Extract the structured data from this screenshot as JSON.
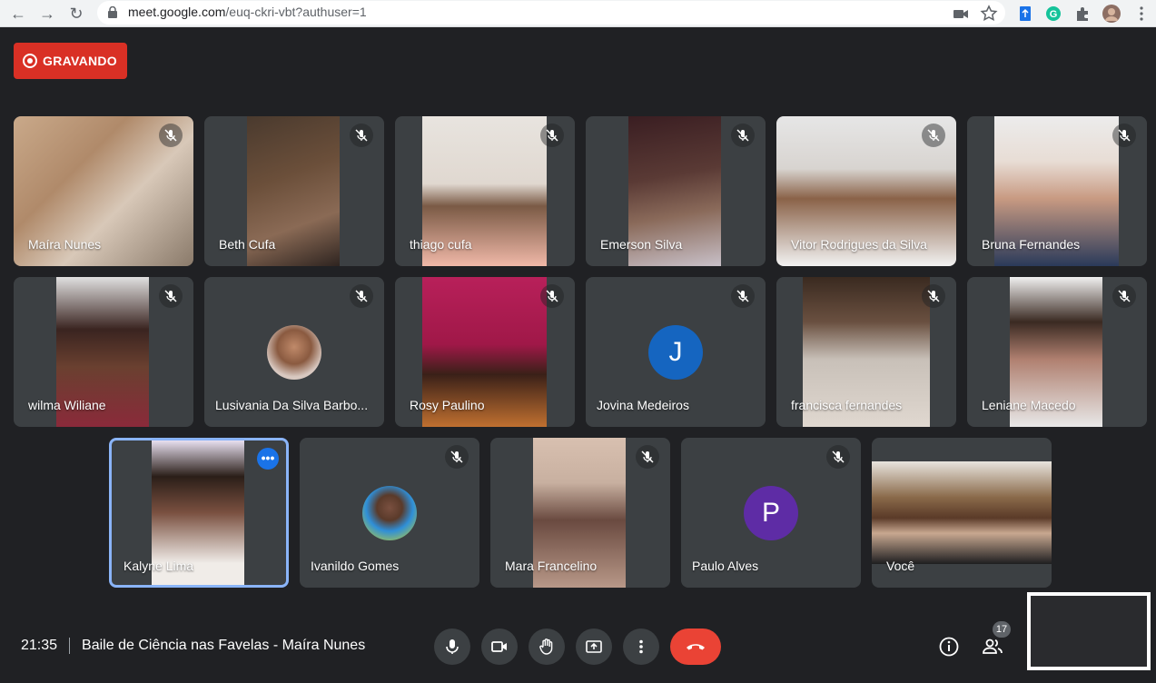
{
  "browser": {
    "url_host": "meet.google.com",
    "url_path": "/euq-ckri-vbt?authuser=1"
  },
  "recording": {
    "label": "GRAVANDO"
  },
  "participants": [
    {
      "name": "Maíra Nunes",
      "type": "video"
    },
    {
      "name": "Beth Cufa",
      "type": "video"
    },
    {
      "name": "thiago cufa",
      "type": "video"
    },
    {
      "name": "Emerson Silva",
      "type": "video"
    },
    {
      "name": "Vitor Rodrigues da Silva",
      "type": "video"
    },
    {
      "name": "Bruna Fernandes",
      "type": "video"
    },
    {
      "name": "wilma Wiliane",
      "type": "video"
    },
    {
      "name": "Lusivania Da Silva Barbo...",
      "type": "avatar-photo"
    },
    {
      "name": "Rosy Paulino",
      "type": "video"
    },
    {
      "name": "Jovina Medeiros",
      "type": "avatar-letter",
      "letter": "J",
      "color": "#1565c0"
    },
    {
      "name": "francisca fernandes",
      "type": "video"
    },
    {
      "name": "Leniane Macedo",
      "type": "video"
    },
    {
      "name": "Kalyne Lima",
      "type": "video",
      "active_speaker": true
    },
    {
      "name": "Ivanildo Gomes",
      "type": "avatar-photo"
    },
    {
      "name": "Mara Francelino",
      "type": "video"
    },
    {
      "name": "Paulo Alves",
      "type": "avatar-letter",
      "letter": "P",
      "color": "#5e2ca5"
    },
    {
      "name": "Você",
      "type": "video",
      "self": true
    }
  ],
  "bottom": {
    "time": "21:35",
    "meeting_title": "Baile de Ciência nas Favelas - Maíra Nunes",
    "participant_count": "17"
  },
  "colors": {
    "background": "#202124",
    "tile": "#3c4043",
    "recording": "#d93025",
    "hangup": "#ea4335",
    "active_outline": "#8ab4f8"
  }
}
